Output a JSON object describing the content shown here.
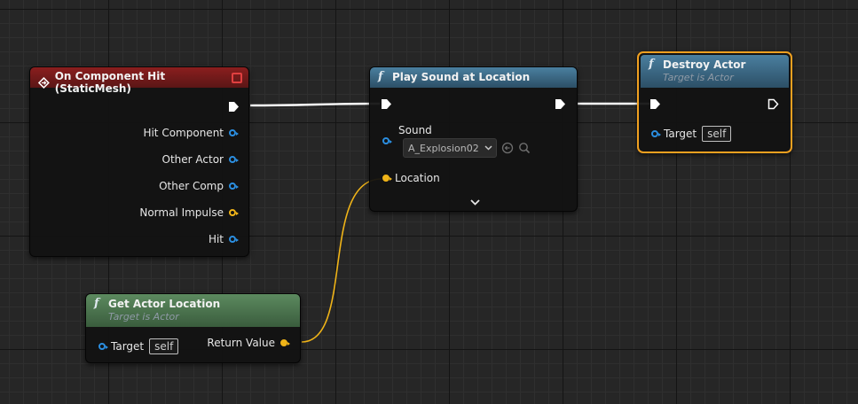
{
  "nodes": {
    "component_hit": {
      "title": "On Component Hit (StaticMesh)",
      "pins": [
        "Hit Component",
        "Other Actor",
        "Other Comp",
        "Normal Impulse",
        "Hit"
      ]
    },
    "play_sound": {
      "title": "Play Sound at Location",
      "sound_label": "Sound",
      "sound_value": "A_Explosion02",
      "location_label": "Location"
    },
    "destroy_actor": {
      "title": "Destroy Actor",
      "subtitle": "Target is Actor",
      "target_label": "Target",
      "target_value": "self"
    },
    "get_actor_location": {
      "title": "Get Actor Location",
      "subtitle": "Target is Actor",
      "target_label": "Target",
      "target_value": "self",
      "return_label": "Return Value"
    }
  },
  "colors": {
    "event_header": "#7a1c1c",
    "function_header": "#3b6b8a",
    "pure_header": "#4f7a52",
    "selected_outline": "#f0a020",
    "object_pin": "#2b8ee0",
    "vector_pin": "#f0b418",
    "exec_wire": "#ffffff"
  },
  "icons": {
    "event": "event-diamond-icon",
    "function": "function-f-icon",
    "close": "close-square-icon",
    "dropdown": "chevron-down-icon",
    "use_selected": "arrow-left-circle-icon",
    "browse": "search-icon",
    "expand": "chevron-down-icon"
  }
}
